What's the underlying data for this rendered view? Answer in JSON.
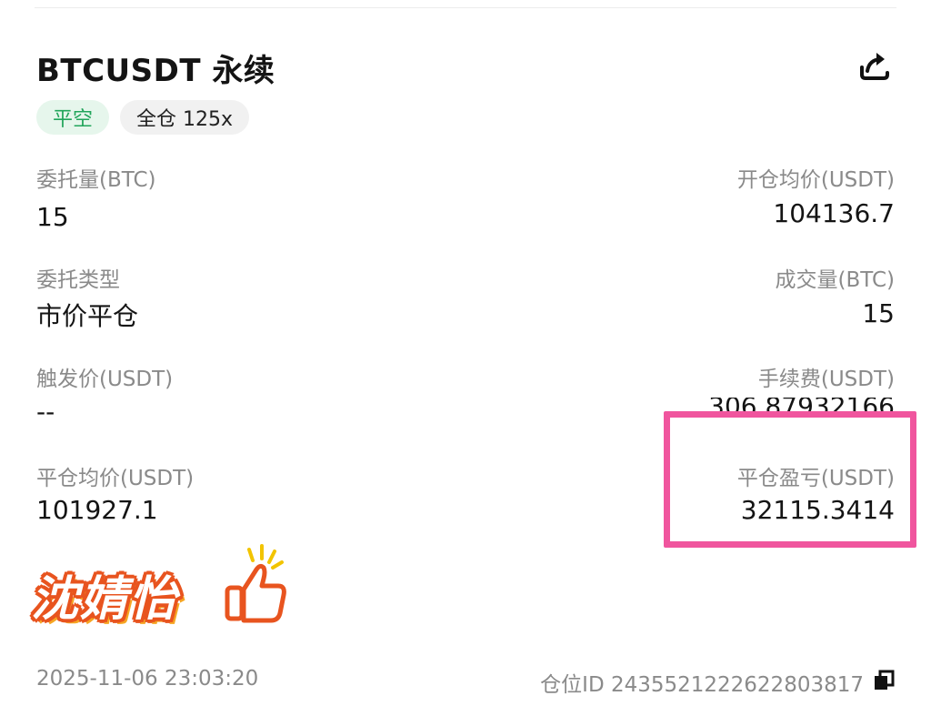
{
  "header": {
    "title": "BTCUSDT 永续",
    "share_icon": "share-icon"
  },
  "tags": {
    "side": "平空",
    "margin": "全仓 125x"
  },
  "fields": {
    "order_qty_label": "委托量(BTC)",
    "order_qty_value": "15",
    "open_avg_label": "开仓均价(USDT)",
    "open_avg_value": "104136.7",
    "order_type_label": "委托类型",
    "order_type_value": "市价平仓",
    "filled_qty_label": "成交量(BTC)",
    "filled_qty_value": "15",
    "trigger_label": "触发价(USDT)",
    "trigger_value": "--",
    "fee_label": "手续费(USDT)",
    "fee_value": "306.87932166",
    "close_avg_label": "平仓均价(USDT)",
    "close_avg_value": "101927.1",
    "pnl_label": "平仓盈亏(USDT)",
    "pnl_value": "32115.3414"
  },
  "overlay": {
    "sticker_text": "沈婧怡",
    "highlight_color": "#f0559e"
  },
  "footer": {
    "timestamp": "2025-11-06 23:03:20",
    "position_id": "仓位ID 2435521222622803817"
  },
  "colors": {
    "accent_green": "#22a55b",
    "label_gray": "#8a8a8a"
  }
}
